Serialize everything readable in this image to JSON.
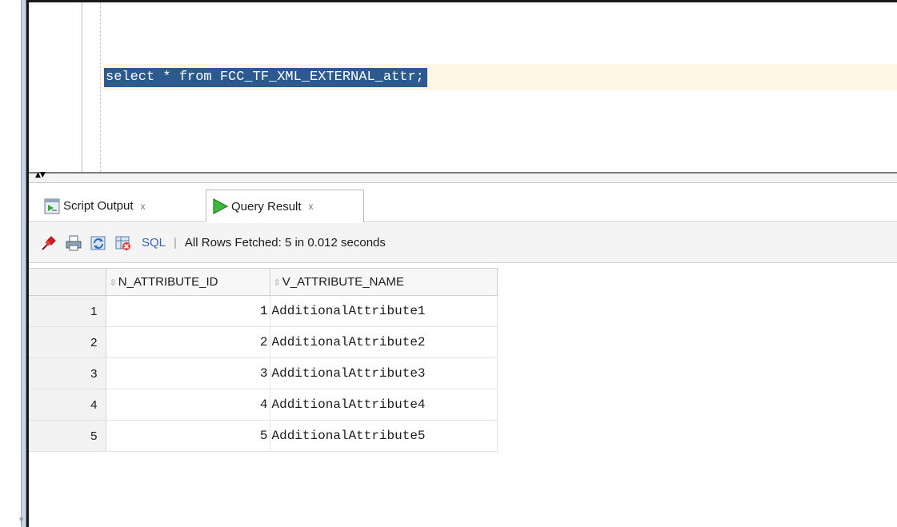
{
  "editor": {
    "sql_text": "select * from FCC_TF_XML_EXTERNAL_attr;"
  },
  "tabs": [
    {
      "label": "Script Output",
      "icon": "script-output-icon",
      "close": "x"
    },
    {
      "label": "Query Result",
      "icon": "run-triangle-icon",
      "close": "x"
    }
  ],
  "toolbar": {
    "sql_label": "SQL",
    "separator": "|",
    "status": "All Rows Fetched: 5 in 0.012 seconds",
    "icons": [
      "pin-icon",
      "print-icon",
      "refresh-icon",
      "clear-icon"
    ]
  },
  "grid": {
    "columns": [
      "N_ATTRIBUTE_ID",
      "V_ATTRIBUTE_NAME"
    ],
    "rows": [
      {
        "num": "1",
        "id": "1",
        "name": "AdditionalAttribute1"
      },
      {
        "num": "2",
        "id": "2",
        "name": "AdditionalAttribute2"
      },
      {
        "num": "3",
        "id": "3",
        "name": "AdditionalAttribute3"
      },
      {
        "num": "4",
        "id": "4",
        "name": "AdditionalAttribute4"
      },
      {
        "num": "5",
        "id": "5",
        "name": "AdditionalAttribute5"
      }
    ]
  },
  "colors": {
    "selection": "#2c5a8f",
    "current_line": "#fdf6e3",
    "sql_link": "#3467b7"
  }
}
